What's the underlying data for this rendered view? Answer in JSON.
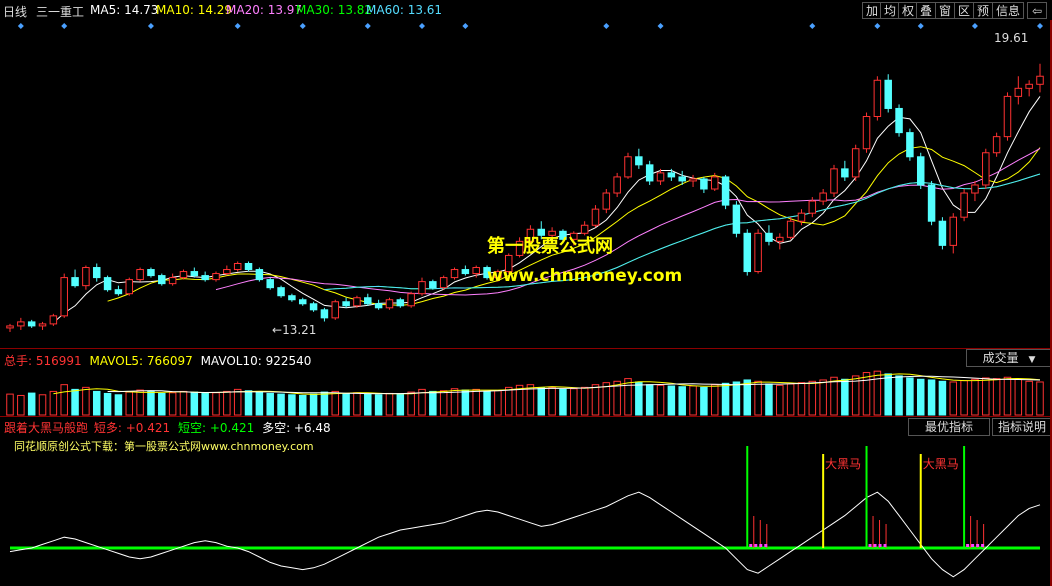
{
  "header": {
    "period": "日线",
    "stock": "三一重工",
    "ma": [
      {
        "label": "MA5: ",
        "value": "14.73",
        "color": "#ffffff"
      },
      {
        "label": "MA10: ",
        "value": "14.29",
        "color": "#ffff00"
      },
      {
        "label": "MA20: ",
        "value": "13.97",
        "color": "#ff80ff"
      },
      {
        "label": "MA30: ",
        "value": "13.82",
        "color": "#00ff00"
      },
      {
        "label": "MA60: ",
        "value": "13.61",
        "color": "#55ddff"
      }
    ],
    "toolbar": [
      "加",
      "均",
      "权",
      "叠",
      "窗",
      "区",
      "预",
      "信息",
      "⇦"
    ]
  },
  "price_panel": {
    "high_label": "19.61",
    "low_label": "13.21",
    "watermark_title": "第一股票公式网",
    "watermark_url": "www.chnmoney.com"
  },
  "volume_panel": {
    "label_total": "总手: ",
    "total": "516991",
    "label_mavol5": "MAVOL5: ",
    "mavol5": "766097",
    "label_mavol10": "MAVOL10: ",
    "mavol10": "922540",
    "tab": "成交量"
  },
  "indicator_panel": {
    "name": "跟着大黑马般跑",
    "label_duan_duo": "短多: ",
    "duan_duo": "+0.421",
    "label_duan_kong": "短空: ",
    "duan_kong": "+0.421",
    "label_duo_kong": "多空: ",
    "duo_kong": "+6.48",
    "subtitle": "同花顺原创公式下载：第一股票公式网www.chnmoney.com",
    "btn_best": "最优指标",
    "btn_help": "指标说明",
    "signal_label": "大黑马"
  },
  "colors": {
    "up": "#ff3232",
    "down": "#54ffff",
    "ma5": "#ffffff",
    "ma10": "#ffff00",
    "ma20": "#ff80ff",
    "ma30": "#00ff00",
    "ma60": "#55ddff",
    "separator": "#8b0000",
    "signal_bar": "#ffff00",
    "signal_text": "#ff3333"
  },
  "chart_data": {
    "type": "candlestick",
    "title": "三一重工 日线",
    "ylim": [
      12.8,
      20.2
    ],
    "candles": [
      [
        13.05,
        13.15,
        12.95,
        13.1
      ],
      [
        13.1,
        13.3,
        13.0,
        13.2
      ],
      [
        13.2,
        13.25,
        13.05,
        13.1
      ],
      [
        13.1,
        13.2,
        13.0,
        13.15
      ],
      [
        13.15,
        13.4,
        13.1,
        13.35
      ],
      [
        13.35,
        14.4,
        13.3,
        14.3
      ],
      [
        14.3,
        14.5,
        14.05,
        14.1
      ],
      [
        14.1,
        14.6,
        14.0,
        14.55
      ],
      [
        14.55,
        14.65,
        14.2,
        14.3
      ],
      [
        14.3,
        14.35,
        13.95,
        14.0
      ],
      [
        14.0,
        14.1,
        13.85,
        13.9
      ],
      [
        13.9,
        14.3,
        13.85,
        14.25
      ],
      [
        14.25,
        14.55,
        14.2,
        14.5
      ],
      [
        14.5,
        14.55,
        14.3,
        14.35
      ],
      [
        14.35,
        14.4,
        14.1,
        14.15
      ],
      [
        14.15,
        14.4,
        14.1,
        14.3
      ],
      [
        14.3,
        14.5,
        14.25,
        14.45
      ],
      [
        14.45,
        14.55,
        14.3,
        14.35
      ],
      [
        14.35,
        14.45,
        14.2,
        14.25
      ],
      [
        14.25,
        14.45,
        14.2,
        14.4
      ],
      [
        14.4,
        14.6,
        14.35,
        14.5
      ],
      [
        14.5,
        14.7,
        14.45,
        14.65
      ],
      [
        14.65,
        14.7,
        14.45,
        14.5
      ],
      [
        14.5,
        14.55,
        14.2,
        14.25
      ],
      [
        14.25,
        14.3,
        14.0,
        14.05
      ],
      [
        14.05,
        14.1,
        13.8,
        13.85
      ],
      [
        13.85,
        13.9,
        13.7,
        13.75
      ],
      [
        13.75,
        13.8,
        13.6,
        13.65
      ],
      [
        13.65,
        13.7,
        13.45,
        13.5
      ],
      [
        13.5,
        13.55,
        13.21,
        13.3
      ],
      [
        13.3,
        13.75,
        13.25,
        13.7
      ],
      [
        13.7,
        13.8,
        13.55,
        13.6
      ],
      [
        13.6,
        13.85,
        13.55,
        13.8
      ],
      [
        13.8,
        13.9,
        13.6,
        13.65
      ],
      [
        13.65,
        13.75,
        13.5,
        13.55
      ],
      [
        13.55,
        13.8,
        13.5,
        13.75
      ],
      [
        13.75,
        13.8,
        13.55,
        13.6
      ],
      [
        13.6,
        13.95,
        13.55,
        13.9
      ],
      [
        13.9,
        14.3,
        13.85,
        14.2
      ],
      [
        14.2,
        14.25,
        14.0,
        14.05
      ],
      [
        14.05,
        14.35,
        14.0,
        14.3
      ],
      [
        14.3,
        14.55,
        14.25,
        14.5
      ],
      [
        14.5,
        14.6,
        14.35,
        14.4
      ],
      [
        14.4,
        14.6,
        14.3,
        14.55
      ],
      [
        14.55,
        14.6,
        14.25,
        14.3
      ],
      [
        14.3,
        14.5,
        14.2,
        14.45
      ],
      [
        14.45,
        14.9,
        14.4,
        14.85
      ],
      [
        14.85,
        15.3,
        14.8,
        15.2
      ],
      [
        15.2,
        15.6,
        15.1,
        15.5
      ],
      [
        15.5,
        15.7,
        15.25,
        15.35
      ],
      [
        15.35,
        15.55,
        15.2,
        15.45
      ],
      [
        15.45,
        15.5,
        15.15,
        15.25
      ],
      [
        15.25,
        15.45,
        15.1,
        15.4
      ],
      [
        15.4,
        15.7,
        15.35,
        15.6
      ],
      [
        15.6,
        16.1,
        15.55,
        16.0
      ],
      [
        16.0,
        16.5,
        15.9,
        16.4
      ],
      [
        16.4,
        16.9,
        16.3,
        16.8
      ],
      [
        16.8,
        17.4,
        16.75,
        17.3
      ],
      [
        17.3,
        17.5,
        17.0,
        17.1
      ],
      [
        17.1,
        17.2,
        16.6,
        16.7
      ],
      [
        16.7,
        17.0,
        16.6,
        16.9
      ],
      [
        16.9,
        17.0,
        16.7,
        16.8
      ],
      [
        16.8,
        16.95,
        16.6,
        16.7
      ],
      [
        16.7,
        16.85,
        16.55,
        16.75
      ],
      [
        16.75,
        16.8,
        16.4,
        16.5
      ],
      [
        16.5,
        16.9,
        16.45,
        16.8
      ],
      [
        16.8,
        16.85,
        16.0,
        16.1
      ],
      [
        16.1,
        16.2,
        15.3,
        15.4
      ],
      [
        15.4,
        15.5,
        14.35,
        14.45
      ],
      [
        14.45,
        15.5,
        14.4,
        15.4
      ],
      [
        15.4,
        15.6,
        15.1,
        15.2
      ],
      [
        15.2,
        15.4,
        15.0,
        15.3
      ],
      [
        15.3,
        15.8,
        15.25,
        15.7
      ],
      [
        15.7,
        16.0,
        15.6,
        15.9
      ],
      [
        15.9,
        16.3,
        15.8,
        16.2
      ],
      [
        16.2,
        16.5,
        16.1,
        16.4
      ],
      [
        16.4,
        17.1,
        16.3,
        17.0
      ],
      [
        17.0,
        17.2,
        16.7,
        16.8
      ],
      [
        16.8,
        17.6,
        16.7,
        17.5
      ],
      [
        17.5,
        18.4,
        17.4,
        18.3
      ],
      [
        18.3,
        19.3,
        18.2,
        19.2
      ],
      [
        19.2,
        19.35,
        18.4,
        18.5
      ],
      [
        18.5,
        18.6,
        17.8,
        17.9
      ],
      [
        17.9,
        18.0,
        17.2,
        17.3
      ],
      [
        17.3,
        17.4,
        16.5,
        16.6
      ],
      [
        16.6,
        16.7,
        15.6,
        15.7
      ],
      [
        15.7,
        15.8,
        15.0,
        15.1
      ],
      [
        15.1,
        15.9,
        14.9,
        15.8
      ],
      [
        15.8,
        16.5,
        15.7,
        16.4
      ],
      [
        16.4,
        16.7,
        16.2,
        16.6
      ],
      [
        16.6,
        17.5,
        16.5,
        17.4
      ],
      [
        17.4,
        17.9,
        17.3,
        17.8
      ],
      [
        17.8,
        18.9,
        17.7,
        18.8
      ],
      [
        18.8,
        19.3,
        18.6,
        19.0
      ],
      [
        19.0,
        19.2,
        18.8,
        19.1
      ],
      [
        19.1,
        19.61,
        18.9,
        19.3
      ]
    ],
    "volume": [
      620,
      580,
      650,
      600,
      700,
      900,
      760,
      820,
      700,
      640,
      600,
      680,
      740,
      700,
      640,
      660,
      700,
      680,
      640,
      660,
      700,
      760,
      720,
      680,
      640,
      620,
      600,
      580,
      620,
      680,
      700,
      640,
      660,
      620,
      600,
      640,
      620,
      680,
      760,
      700,
      720,
      780,
      740,
      760,
      700,
      720,
      820,
      880,
      900,
      800,
      820,
      760,
      780,
      820,
      900,
      960,
      1000,
      1080,
      980,
      900,
      880,
      860,
      840,
      860,
      820,
      900,
      940,
      980,
      1040,
      1000,
      920,
      880,
      920,
      960,
      1000,
      1040,
      1120,
      1060,
      1160,
      1260,
      1300,
      1220,
      1160,
      1100,
      1060,
      1040,
      1000,
      980,
      1020,
      1060,
      1100,
      1080,
      1120,
      1060,
      1000,
      980
    ],
    "mavol5": 766097,
    "mavol10": 922540,
    "indicator_signals": [
      68,
      79,
      88
    ],
    "indicator_line": [
      -0.2,
      -0.1,
      0.0,
      0.2,
      0.4,
      0.6,
      0.5,
      0.3,
      0.1,
      -0.1,
      -0.3,
      -0.5,
      -0.6,
      -0.5,
      -0.3,
      -0.1,
      0.1,
      0.3,
      0.4,
      0.3,
      0.1,
      0.0,
      -0.2,
      -0.5,
      -0.8,
      -1.0,
      -1.1,
      -1.2,
      -1.1,
      -0.9,
      -0.6,
      -0.3,
      0.0,
      0.3,
      0.6,
      0.8,
      1.0,
      1.1,
      1.2,
      1.3,
      1.4,
      1.6,
      1.8,
      2.0,
      2.1,
      2.0,
      1.8,
      1.6,
      1.4,
      1.2,
      1.3,
      1.5,
      1.7,
      1.9,
      2.1,
      2.3,
      2.6,
      2.9,
      3.1,
      2.8,
      2.4,
      2.0,
      1.6,
      1.2,
      0.8,
      0.4,
      0.0,
      -0.6,
      -1.2,
      -1.4,
      -1.0,
      -0.6,
      -0.2,
      0.2,
      0.6,
      1.0,
      1.4,
      1.8,
      2.3,
      2.8,
      3.1,
      2.6,
      1.8,
      1.0,
      0.2,
      -0.6,
      -1.2,
      -1.6,
      -1.2,
      -0.6,
      0.0,
      0.6,
      1.2,
      1.8,
      2.2,
      2.4
    ]
  }
}
